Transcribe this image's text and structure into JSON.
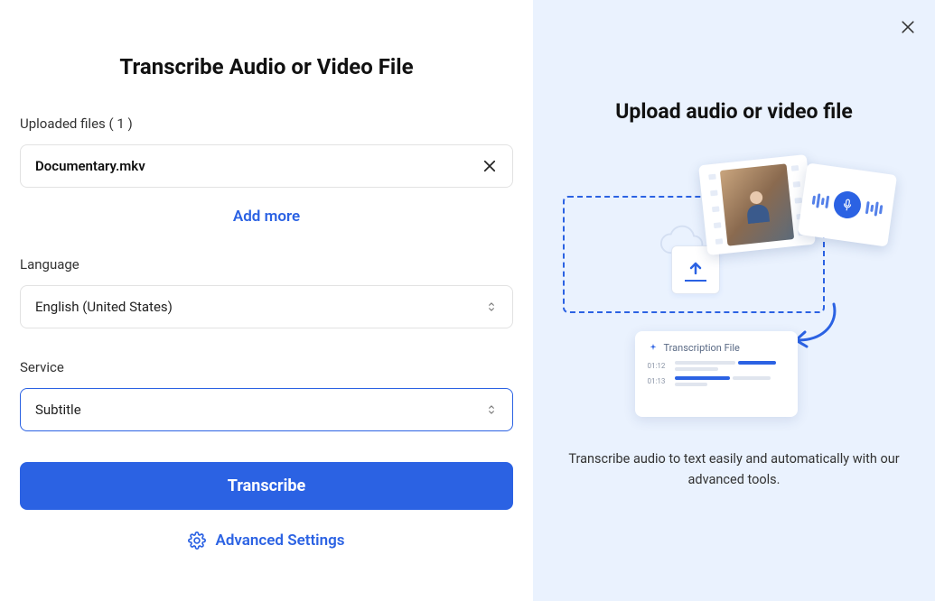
{
  "left": {
    "title": "Transcribe Audio or Video File",
    "uploaded_label": "Uploaded files ( 1 )",
    "file_name": "Documentary.mkv",
    "add_more": "Add more",
    "language_label": "Language",
    "language_value": "English (United States)",
    "service_label": "Service",
    "service_value": "Subtitle",
    "transcribe_btn": "Transcribe",
    "advanced": "Advanced Settings"
  },
  "right": {
    "title": "Upload audio or video file",
    "trans_card_title": "Transcription File",
    "ts1": "01:12",
    "ts2": "01:13",
    "desc": "Transcribe audio to text easily and automatically with our advanced tools."
  },
  "colors": {
    "primary": "#2b62e3",
    "panel_bg": "#eaf2fe"
  }
}
